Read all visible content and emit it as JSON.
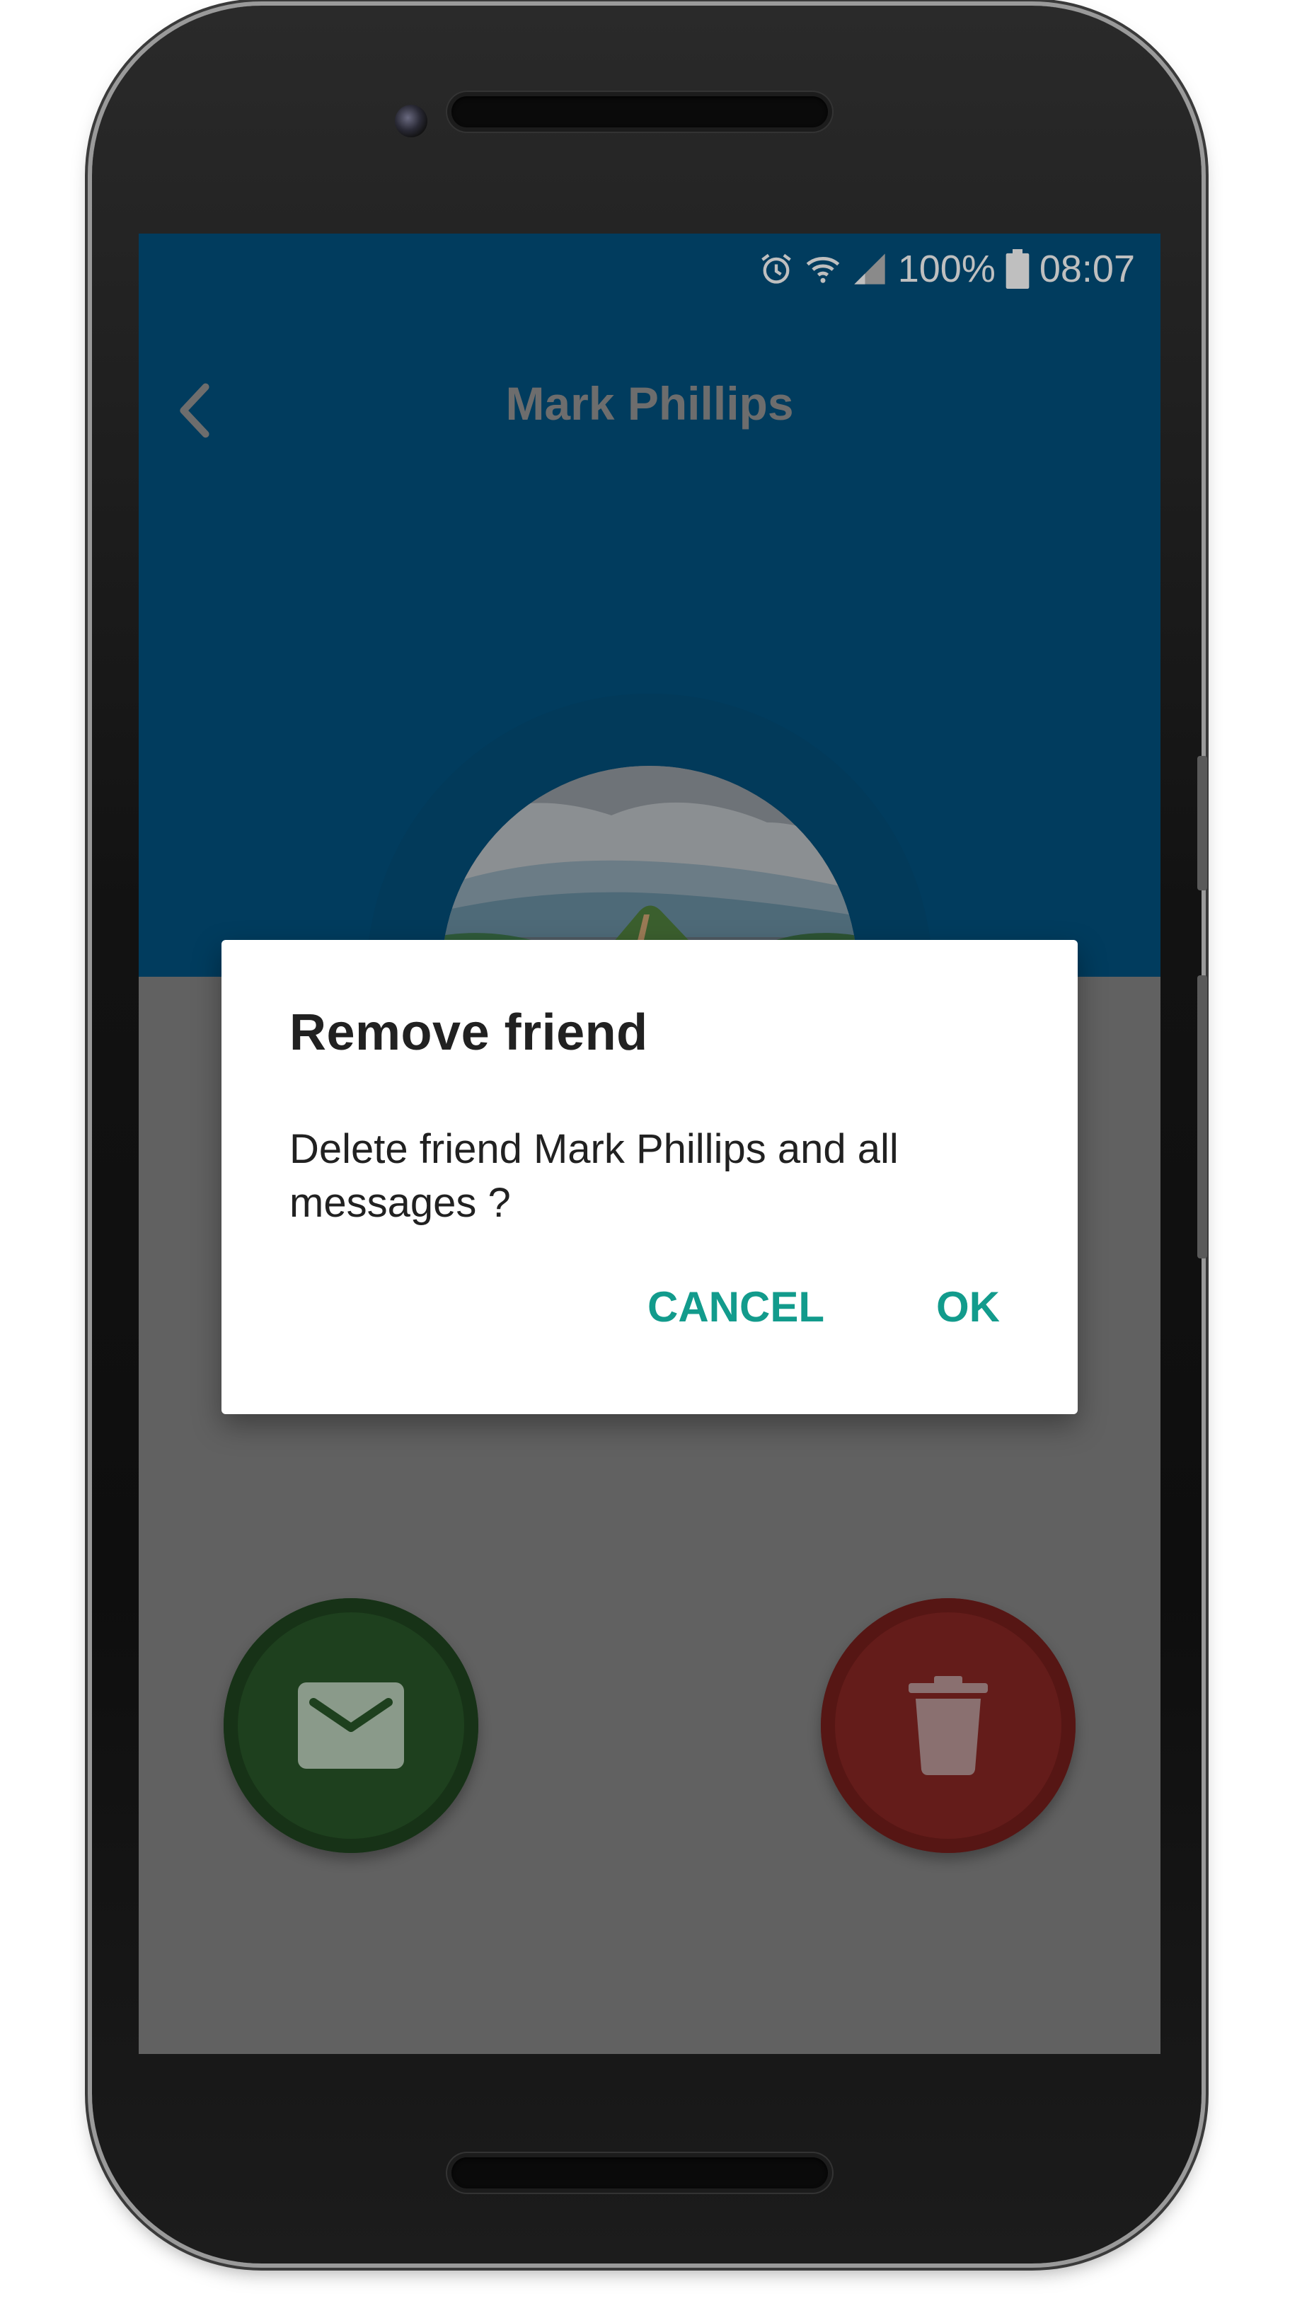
{
  "status_bar": {
    "battery": "100%",
    "time": "08:07",
    "icons": [
      "alarm-icon",
      "wifi-icon",
      "signal-icon",
      "battery-icon"
    ]
  },
  "toolbar": {
    "title": "Mark Phillips",
    "back_icon": "chevron-left-icon"
  },
  "profile": {
    "avatar_alt": "landscape-photo"
  },
  "dialog": {
    "title": "Remove friend",
    "message": "Delete friend Mark Phillips and all messages ?",
    "cancel_label": "CANCEL",
    "ok_label": "OK"
  },
  "actions": {
    "message_icon": "envelope-icon",
    "delete_icon": "trash-icon"
  },
  "colors": {
    "header": "#013c5e",
    "scrim": "#616161",
    "dialog_accent": "#129b8c",
    "message_fab": "#1e401e",
    "delete_fab": "#641c1a"
  }
}
